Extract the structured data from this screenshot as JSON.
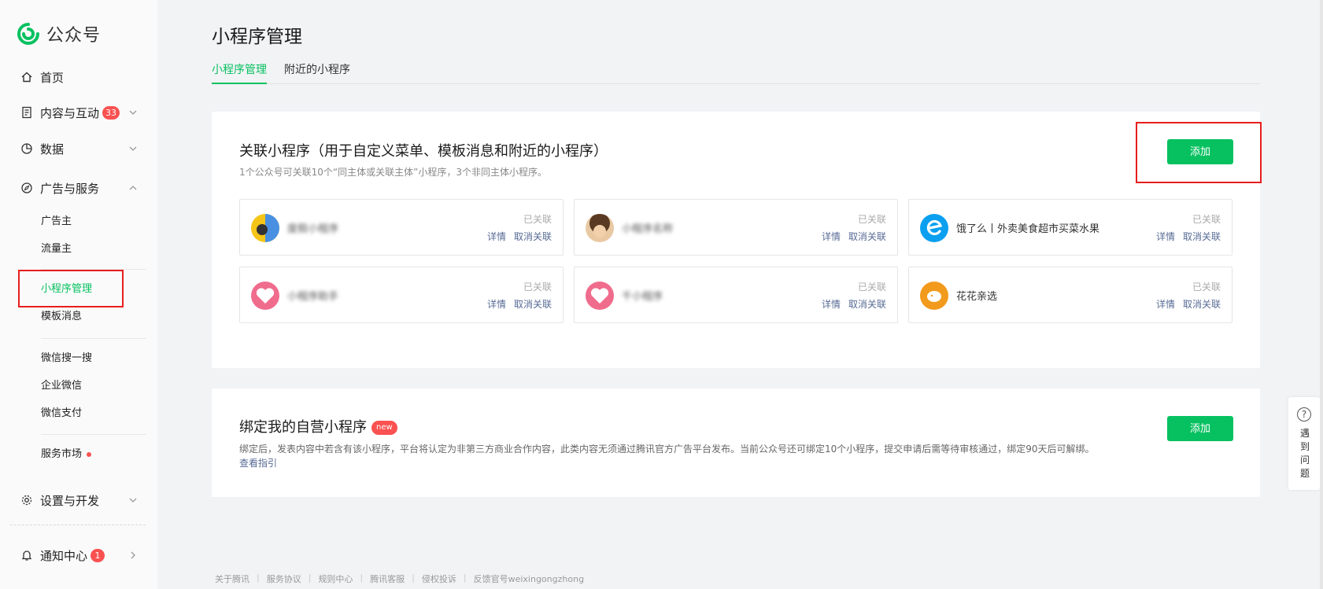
{
  "brand": {
    "name": "公众号"
  },
  "sidebar": {
    "home": "首页",
    "content": {
      "label": "内容与互动",
      "badge": "33"
    },
    "data": "数据",
    "ads": {
      "label": "广告与服务"
    },
    "ads_sub": [
      "广告主",
      "流量主",
      "小程序管理",
      "模板消息"
    ],
    "ads_sub2": [
      "微信搜一搜",
      "企业微信",
      "微信支付"
    ],
    "market": "服务市场",
    "settings": "设置与开发",
    "notify": {
      "label": "通知中心",
      "badge": "1"
    }
  },
  "page": {
    "title": "小程序管理",
    "tabs": [
      "小程序管理",
      "附近的小程序"
    ]
  },
  "linked": {
    "title": "关联小程序（用于自定义菜单、模板消息和附近的小程序）",
    "desc": "1个公众号可关联10个“同主体或关联主体”小程序，3个非同主体小程序。",
    "add": "添加",
    "items": [
      {
        "name": "度假小程序",
        "status": "已关联",
        "detail": "详情",
        "unlink": "取消关联"
      },
      {
        "name": "小程序名称",
        "status": "已关联",
        "detail": "详情",
        "unlink": "取消关联"
      },
      {
        "name": "饿了么丨外卖美食超市买菜水果",
        "status": "已关联",
        "detail": "详情",
        "unlink": "取消关联"
      },
      {
        "name": "小程序助手",
        "status": "已关联",
        "detail": "详情",
        "unlink": "取消关联"
      },
      {
        "name": "千小程序",
        "status": "已关联",
        "detail": "详情",
        "unlink": "取消关联"
      },
      {
        "name": "花花亲选",
        "status": "已关联",
        "detail": "详情",
        "unlink": "取消关联"
      }
    ]
  },
  "bind": {
    "title": "绑定我的自营小程序",
    "badge": "new",
    "desc": "绑定后，发表内容中若含有该小程序，平台将认定为非第三方商业合作内容，此类内容无须通过腾讯官方广告平台发布。当前公众号还可绑定10个小程序，提交申请后需等待审核通过，绑定90天后可解绑。",
    "guide": "查看指引",
    "add": "添加"
  },
  "footer": [
    "关于腾讯",
    "服务协议",
    "规则中心",
    "腾讯客服",
    "侵权投诉",
    "反馈官号weixingongzhong"
  ],
  "help": {
    "label": "遇到问题"
  },
  "colors": {
    "accent": "#07c160",
    "link": "#576b95",
    "badge": "#fa5151"
  }
}
